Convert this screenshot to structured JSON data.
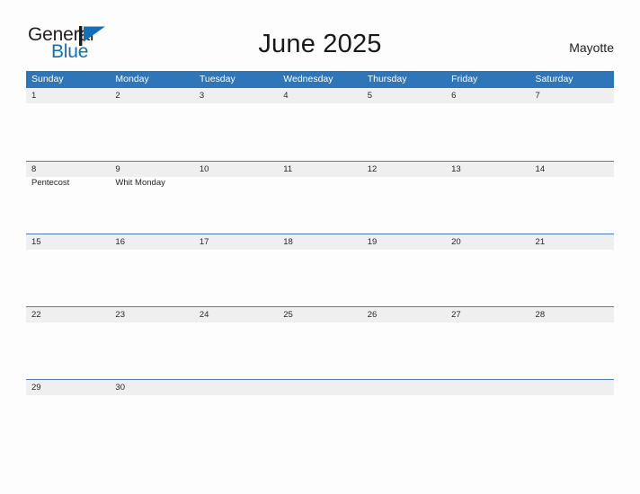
{
  "brand": {
    "word1": "General",
    "word2": "Blue",
    "flag_icon": "blue-pennant-flag",
    "word1_color": "#231f20",
    "word2_color": "#1270b8"
  },
  "header": {
    "title": "June 2025",
    "region": "Mayotte"
  },
  "colors": {
    "header_blue": "#2e76b8",
    "row_gray": "#efefef",
    "row_divider": "#4a7ebb",
    "page_background": "#fdfdfd",
    "text": "#262626"
  },
  "calendar": {
    "weekdays": [
      "Sunday",
      "Monday",
      "Tuesday",
      "Wednesday",
      "Thursday",
      "Friday",
      "Saturday"
    ],
    "weeks": [
      {
        "days": [
          {
            "date": "1",
            "events": []
          },
          {
            "date": "2",
            "events": []
          },
          {
            "date": "3",
            "events": []
          },
          {
            "date": "4",
            "events": []
          },
          {
            "date": "5",
            "events": []
          },
          {
            "date": "6",
            "events": []
          },
          {
            "date": "7",
            "events": []
          }
        ]
      },
      {
        "days": [
          {
            "date": "8",
            "events": [
              "Pentecost"
            ]
          },
          {
            "date": "9",
            "events": [
              "Whit Monday"
            ]
          },
          {
            "date": "10",
            "events": []
          },
          {
            "date": "11",
            "events": []
          },
          {
            "date": "12",
            "events": []
          },
          {
            "date": "13",
            "events": []
          },
          {
            "date": "14",
            "events": []
          }
        ]
      },
      {
        "days": [
          {
            "date": "15",
            "events": []
          },
          {
            "date": "16",
            "events": []
          },
          {
            "date": "17",
            "events": []
          },
          {
            "date": "18",
            "events": []
          },
          {
            "date": "19",
            "events": []
          },
          {
            "date": "20",
            "events": []
          },
          {
            "date": "21",
            "events": []
          }
        ]
      },
      {
        "days": [
          {
            "date": "22",
            "events": []
          },
          {
            "date": "23",
            "events": []
          },
          {
            "date": "24",
            "events": []
          },
          {
            "date": "25",
            "events": []
          },
          {
            "date": "26",
            "events": []
          },
          {
            "date": "27",
            "events": []
          },
          {
            "date": "28",
            "events": []
          }
        ]
      },
      {
        "last": true,
        "days": [
          {
            "date": "29",
            "events": []
          },
          {
            "date": "30",
            "events": []
          },
          {
            "date": "",
            "events": []
          },
          {
            "date": "",
            "events": []
          },
          {
            "date": "",
            "events": []
          },
          {
            "date": "",
            "events": []
          },
          {
            "date": "",
            "events": []
          }
        ]
      }
    ]
  }
}
